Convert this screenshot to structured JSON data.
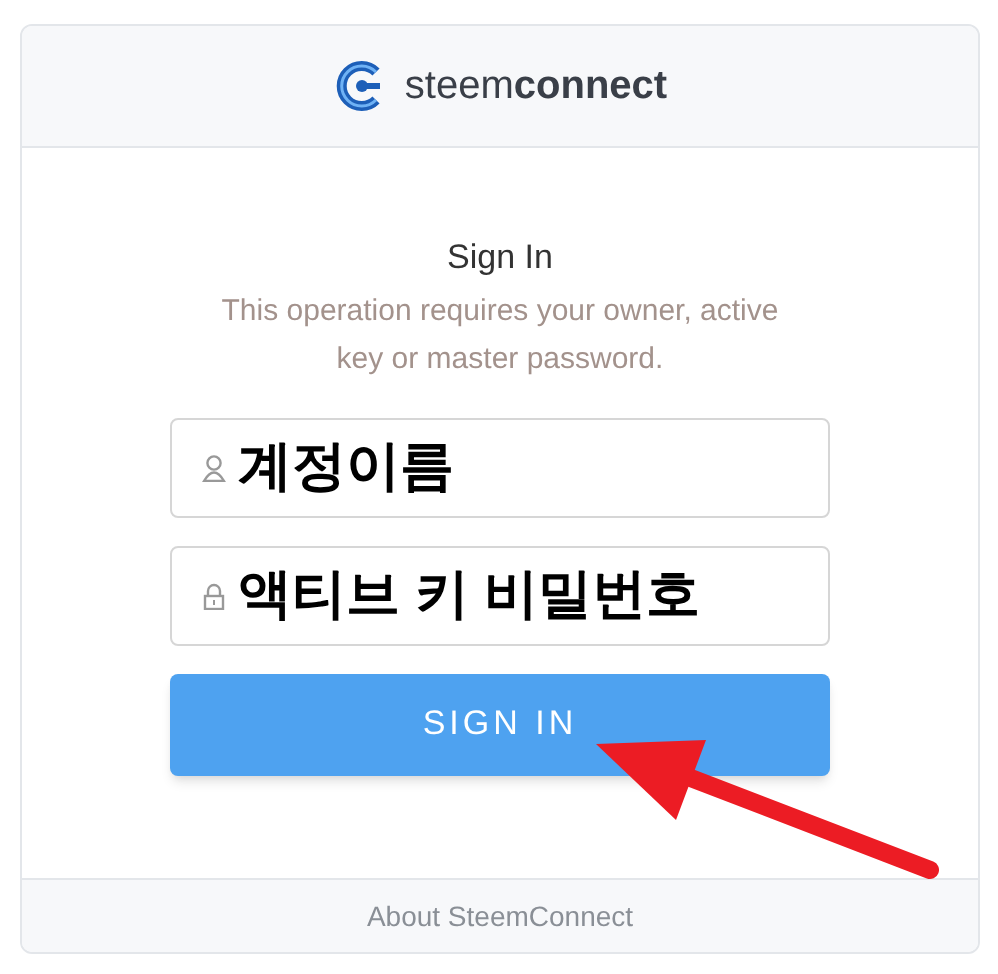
{
  "header": {
    "logo_text": "steem**connect**"
  },
  "title": "Sign In",
  "description": "This operation requires your owner, active key or master password.",
  "fields": [
    {
      "kind": "user",
      "annotation": "계정이름"
    },
    {
      "kind": "lock",
      "annotation": "액티브 키 비밀번호"
    }
  ],
  "button": "SIGN IN",
  "footer": "About SteemConnect"
}
